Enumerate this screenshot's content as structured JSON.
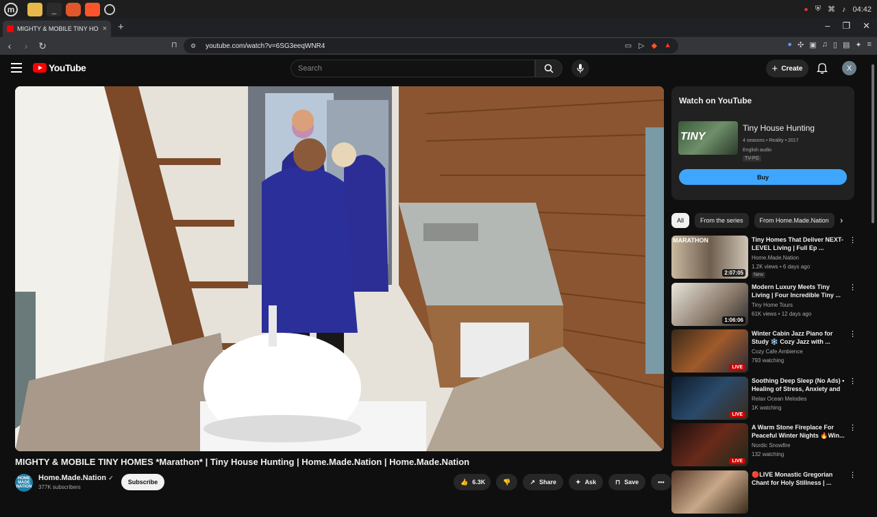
{
  "browser": {
    "tab_title": "MIGHTY & MOBILE TINY HO",
    "tab_close": "×",
    "new_tab": "+",
    "url": "youtube.com/watch?v=6SG3eeqWNR4",
    "clock": "04:42"
  },
  "header": {
    "logo_text": "YouTube",
    "search_placeholder": "Search",
    "create_label": "Create",
    "avatar_letter": "X"
  },
  "video": {
    "title": "MIGHTY & MOBILE TINY HOMES *Marathon* | Tiny House Hunting | Home.Made.Nation | Home.Made.Nation",
    "channel": "Home.Made.Nation",
    "subscribers": "377K subscribers",
    "subscribe_label": "Subscribe",
    "likes": "6.3K",
    "share_label": "Share",
    "ask_label": "Ask",
    "save_label": "Save",
    "avatar_text": "HOME MADE NATION"
  },
  "promo": {
    "heading": "Watch on YouTube",
    "thumb_text": "TINY",
    "title": "Tiny House Hunting",
    "meta1": "4 seasons • Reality • 2017",
    "meta2": "English audio",
    "rating": "TV-PG",
    "buy_label": "Buy"
  },
  "chips": [
    {
      "label": "All"
    },
    {
      "label": "From the series"
    },
    {
      "label": "From Home.Made.Nation"
    }
  ],
  "recommendations": [
    {
      "title": "Tiny Homes That Deliver NEXT-LEVEL Living | Full Ep ...",
      "channel": "Home.Made.Nation",
      "meta": "1.2K views • 6 days ago",
      "badge": "2:07:05",
      "new": "New",
      "thumb_text": "MARATHON"
    },
    {
      "title": "Modern Luxury Meets Tiny Living | Four Incredible Tiny ...",
      "channel": "Tiny Home Tours",
      "meta": "61K views • 12 days ago",
      "badge": "1:06:06"
    },
    {
      "title": "Winter Cabin Jazz Piano for Study ❄️ Cozy Jazz with ...",
      "channel": "Cozy Cafe Ambience",
      "meta": "793 watching",
      "badge": "LIVE"
    },
    {
      "title": "Soothing Deep Sleep (No Ads) • Healing of Stress, Anxiety and ...",
      "channel": "Relax Ocean Melodies",
      "meta": "1K watching",
      "badge": "LIVE"
    },
    {
      "title": "A Warm Stone Fireplace For Peaceful Winter Nights 🔥Win...",
      "channel": "Nordic Snowfire",
      "meta": "132 watching",
      "badge": "LIVE"
    },
    {
      "title": "🔴LIVE Monastic Gregorian Chant for Holy Stillness | ...",
      "channel": "",
      "meta": "",
      "badge": ""
    }
  ]
}
